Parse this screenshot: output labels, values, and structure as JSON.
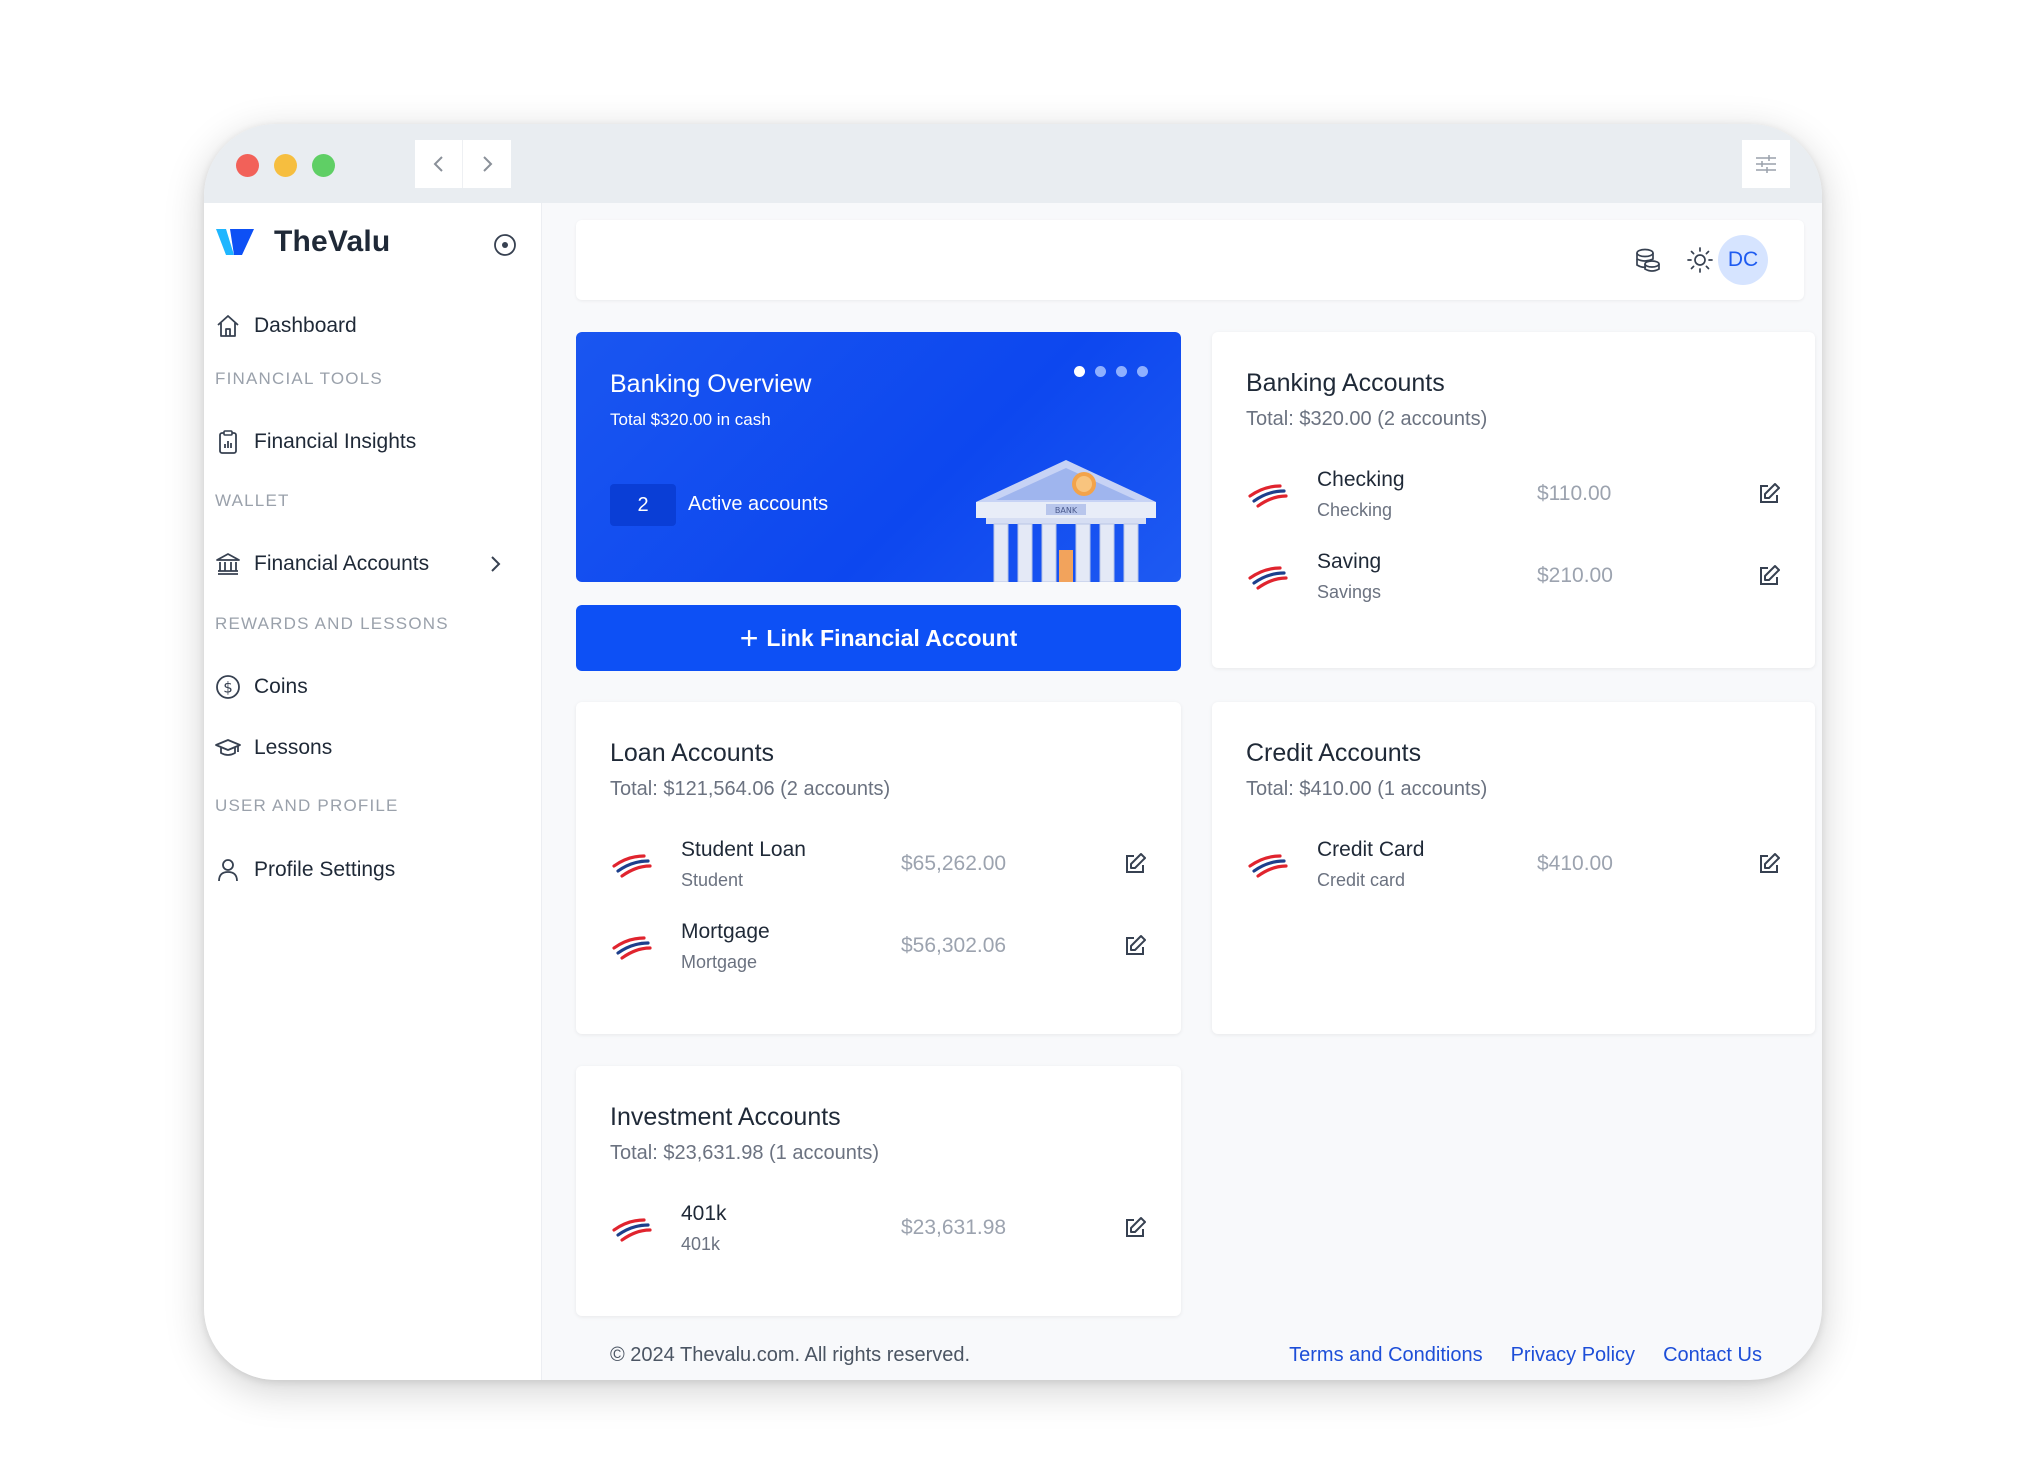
{
  "app": {
    "name": "TheValu"
  },
  "sidebar": {
    "dashboard": "Dashboard",
    "sections": [
      {
        "label": "FINANCIAL TOOLS",
        "items": [
          {
            "label": "Financial Insights"
          }
        ]
      },
      {
        "label": "WALLET",
        "items": [
          {
            "label": "Financial Accounts"
          }
        ]
      },
      {
        "label": "REWARDS AND LESSONS",
        "items": [
          {
            "label": "Coins"
          },
          {
            "label": "Lessons"
          }
        ]
      },
      {
        "label": "USER AND PROFILE",
        "items": [
          {
            "label": "Profile Settings"
          }
        ]
      }
    ]
  },
  "header": {
    "avatar_initials": "DC"
  },
  "overview": {
    "title": "Banking Overview",
    "subtitle": "Total $320.00 in cash",
    "active_count": "2",
    "active_label": "Active accounts",
    "bank_sign": "BANK",
    "dots_total": 4,
    "dots_active": 1
  },
  "link_button": {
    "plus": "+",
    "label": "Link Financial Account"
  },
  "banking": {
    "title": "Banking Accounts",
    "total": "Total: $320.00 (2 accounts)",
    "accounts": [
      {
        "name": "Checking",
        "type": "Checking",
        "amount": "$110.00"
      },
      {
        "name": "Saving",
        "type": "Savings",
        "amount": "$210.00"
      }
    ]
  },
  "loan": {
    "title": "Loan Accounts",
    "total": "Total: $121,564.06 (2 accounts)",
    "accounts": [
      {
        "name": "Student Loan",
        "type": "Student",
        "amount": "$65,262.00"
      },
      {
        "name": "Mortgage",
        "type": "Mortgage",
        "amount": "$56,302.06"
      }
    ]
  },
  "credit": {
    "title": "Credit Accounts",
    "total": "Total: $410.00 (1 accounts)",
    "accounts": [
      {
        "name": "Credit Card",
        "type": "Credit card",
        "amount": "$410.00"
      }
    ]
  },
  "investment": {
    "title": "Investment Accounts",
    "total": "Total: $23,631.98 (1 accounts)",
    "accounts": [
      {
        "name": "401k",
        "type": "401k",
        "amount": "$23,631.98"
      }
    ]
  },
  "footer": {
    "copyright": "© 2024 Thevalu.com. All rights reserved.",
    "links": [
      "Terms and Conditions",
      "Privacy Policy",
      "Contact Us"
    ]
  },
  "colors": {
    "primary": "#0d50f5",
    "hero": "#1a56f0",
    "text": "#1f2937",
    "muted": "#6b7280",
    "link": "#1d4ed8"
  },
  "icons": [
    "home-icon",
    "clipboard-icon",
    "bank-icon",
    "dollar-coin-icon",
    "graduation-cap-icon",
    "user-icon",
    "coins-icon",
    "sun-icon",
    "edit-icon",
    "bank-logo-icon"
  ]
}
